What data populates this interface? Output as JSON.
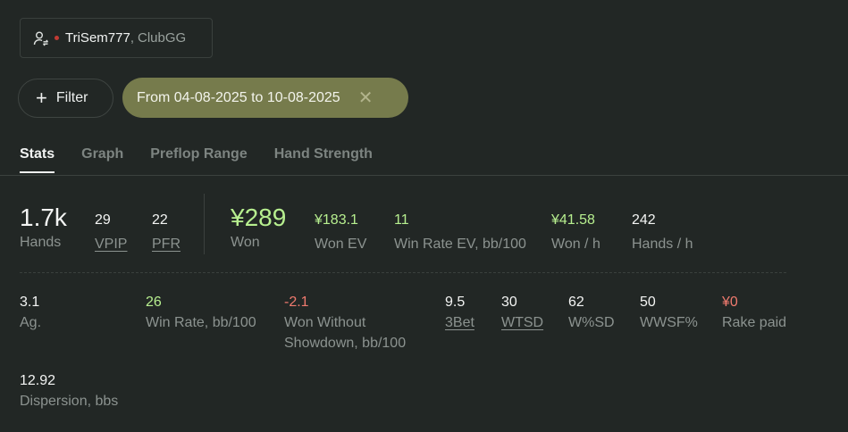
{
  "player": {
    "name": "TriSem777",
    "separator": ",",
    "club": "ClubGG"
  },
  "filter": {
    "label": "Filter"
  },
  "date_range": {
    "label": "From 04-08-2025 to 10-08-2025"
  },
  "tabs": [
    {
      "label": "Stats",
      "active": true
    },
    {
      "label": "Graph",
      "active": false
    },
    {
      "label": "Preflop Range",
      "active": false
    },
    {
      "label": "Hand Strength",
      "active": false
    }
  ],
  "summary": {
    "hands": {
      "value": "1.7k",
      "label": "Hands"
    },
    "vpip": {
      "value": "29",
      "label": "VPIP"
    },
    "pfr": {
      "value": "22",
      "label": "PFR"
    },
    "won": {
      "value": "¥289",
      "label": "Won"
    },
    "won_ev": {
      "value": "¥183.1",
      "label": "Won EV"
    },
    "win_rate_ev": {
      "value": "11",
      "label": "Win Rate EV, bb/100"
    },
    "won_per_hour": {
      "value": "¥41.58",
      "label": "Won / h"
    },
    "hands_per_hour": {
      "value": "242",
      "label": "Hands / h"
    }
  },
  "details": {
    "ag": {
      "value": "3.1",
      "label": "Ag."
    },
    "win_rate": {
      "value": "26",
      "label": "Win Rate, bb/100"
    },
    "wwsd": {
      "value": "-2.1",
      "label": "Won Without",
      "label2": "Showdown, bb/100"
    },
    "threebet": {
      "value": "9.5",
      "label": "3Bet"
    },
    "wtsd": {
      "value": "30",
      "label": "WTSD"
    },
    "wsd": {
      "value": "62",
      "label": "W%SD"
    },
    "wwsf": {
      "value": "50",
      "label": "WWSF%"
    },
    "rake": {
      "value": "¥0",
      "label": "Rake paid"
    },
    "dispersion": {
      "value": "12.92",
      "label": "Dispersion, bbs"
    }
  },
  "colors": {
    "positive": "#b7ef8f",
    "negative": "#ef7a6e",
    "date_chip": "#767b4c"
  },
  "icons": {
    "player": "user-switch-icon",
    "filter": "plus-icon",
    "clear": "close-icon"
  }
}
